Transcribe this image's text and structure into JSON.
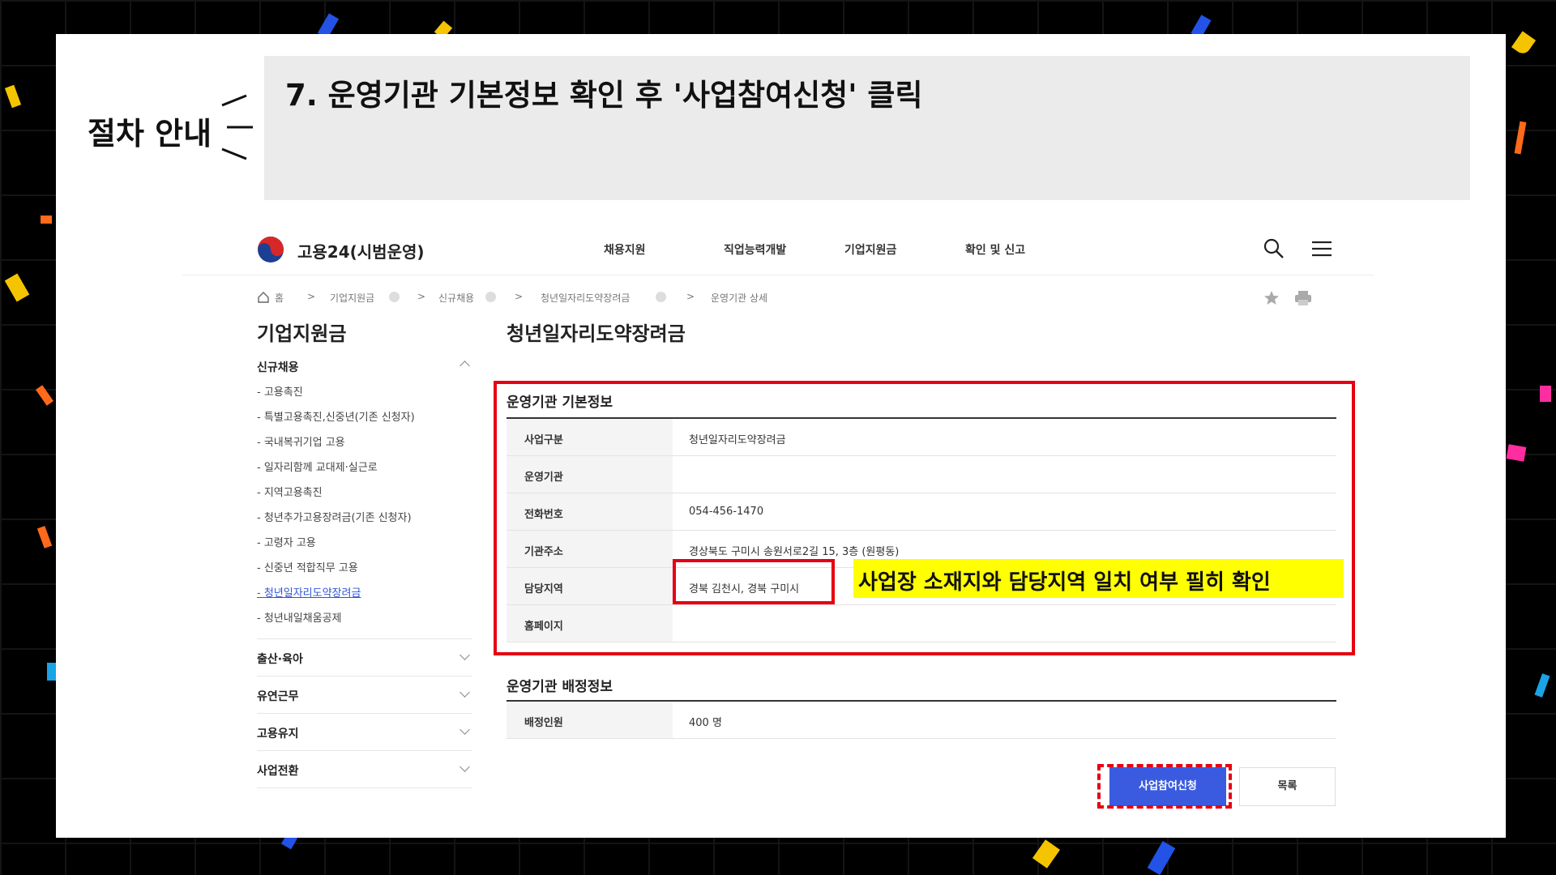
{
  "slide": {
    "section_label": "절차 안내",
    "step_title": "7. 운영기관 기본정보 확인 후 '사업참여신청' 클릭",
    "callout": "사업장 소재지와 담당지역 일치 여부 필히 확인"
  },
  "header": {
    "brand": "고용24(시범운영)",
    "nav": [
      "채용지원",
      "직업능력개발",
      "기업지원금",
      "확인 및 신고"
    ],
    "icons": [
      "search-icon",
      "menu-icon"
    ]
  },
  "breadcrumb": [
    "홈",
    "기업지원금",
    "신규채용",
    "청년일자리도약장려금",
    "운영기관 상세"
  ],
  "sidebar": {
    "title": "기업지원금",
    "group": "신규채용",
    "items": [
      "- 고용촉진",
      "- 특별고용촉진,신중년(기존 신청자)",
      "- 국내복귀기업 고용",
      "- 일자리함께 교대제·실근로",
      "- 지역고용촉진",
      "- 청년추가고용장려금(기존 신청자)",
      "- 고령자 고용",
      "- 신중년 적합직무 고용",
      "- 청년일자리도약장려금",
      "- 청년내일채움공제"
    ],
    "active_index": 8,
    "sections": [
      "출산·육아",
      "유연근무",
      "고용유지",
      "사업전환"
    ]
  },
  "main": {
    "title": "청년일자리도약장려금",
    "basic_info_title": "운영기관 기본정보",
    "basic_info": [
      {
        "label": "사업구분",
        "value": "청년일자리도약장려금"
      },
      {
        "label": "운영기관",
        "value": ""
      },
      {
        "label": "전화번호",
        "value": "054-456-1470"
      },
      {
        "label": "기관주소",
        "value": "경상북도 구미시 송원서로2길 15, 3층 (원평동)"
      },
      {
        "label": "담당지역",
        "value": "경북 김천시, 경북 구미시"
      },
      {
        "label": "홈페이지",
        "value": ""
      }
    ],
    "assign_info_title": "운영기관 배정정보",
    "assign_info": [
      {
        "label": "배정인원",
        "value": "400 명"
      }
    ],
    "apply_button": "사업참여신청",
    "list_button": "목록"
  },
  "colors": {
    "highlight_red": "#e60012",
    "callout_yellow": "#ffff00",
    "button_blue": "#3a5be0",
    "link_blue": "#3155d6"
  }
}
